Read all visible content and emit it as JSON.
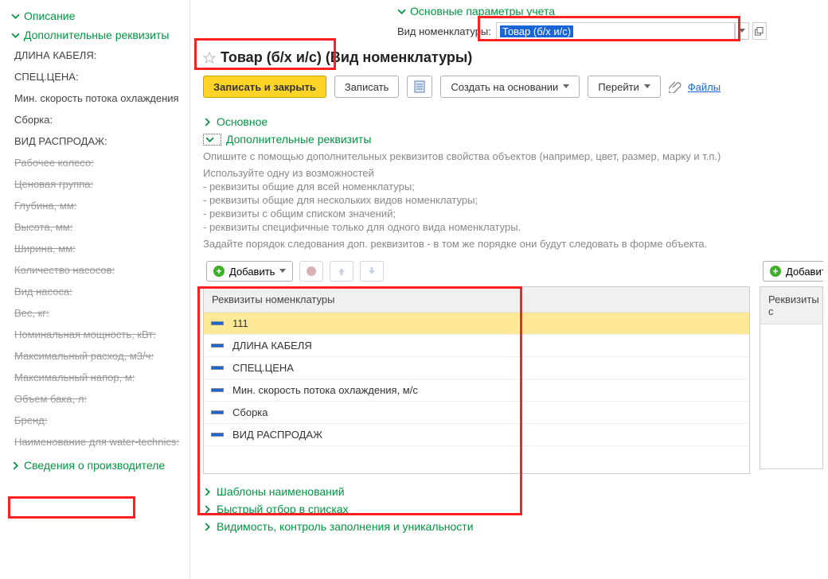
{
  "left": {
    "sec_desc": "Описание",
    "sec_addl": "Дополнительные реквизиты",
    "items_plain": [
      "ДЛИНА КАБЕЛЯ:",
      "СПЕЦ.ЦЕНА:",
      "Мин. скорость потока охлаждения",
      "Сборка:",
      "ВИД РАСПРОДАЖ:"
    ],
    "items_struck": [
      "Рабочее колесо:",
      "Ценовая группа:",
      "Глубина, мм:",
      "Высота, мм:",
      "Ширина, мм:",
      "Количество насосов:",
      "Вид насоса:",
      "Вес, кг:",
      "Номинальная мощность, кВт:",
      "Максимальный расход, м3/ч:",
      "Максимальный напор, м:",
      "Объем бака, л:",
      "Бренд:",
      "Наименование для water-technics:"
    ],
    "sec_manufacturer": "Сведения о производителе"
  },
  "right": {
    "top_sec": "Основные параметры учета",
    "field_label": "Вид номенклатуры:",
    "field_value": "Товар (б/х и/с)",
    "title": "Товар (б/х и/с) (Вид номенклатуры)",
    "btn_save_close": "Записать и закрыть",
    "btn_save": "Записать",
    "btn_create": "Создать на основании",
    "btn_goto": "Перейти",
    "link_files": "Файлы",
    "sec_main": "Основное",
    "sec_addl": "Дополнительные реквизиты",
    "desc1": "Опишите с помощью дополнительных реквизитов свойства объектов (например, цвет, размер, марку и т.п.)",
    "desc2": "Используйте одну из возможностей",
    "desc_list": [
      "- реквизиты общие для всей номенклатуры;",
      "- реквизиты общие для нескольких видов номенклатуры;",
      "- реквизиты с общим списком значений;",
      "- реквизиты специфичные только для одного вида номенклатуры."
    ],
    "desc3": "Задайте порядок следования доп. реквизитов - в том же порядке они будут следовать в форме объекта.",
    "btn_add": "Добавить",
    "grid_header": "Реквизиты номенклатуры",
    "grid_rows": [
      "111",
      "ДЛИНА КАБЕЛЯ",
      "СПЕЦ.ЦЕНА",
      "Мин. скорость потока охлаждения, м/с",
      "Сборка",
      "ВИД РАСПРОДАЖ"
    ],
    "side_btn_add": "Добавит",
    "side_header": "Реквизиты с",
    "sec_templates": "Шаблоны наименований",
    "sec_filter": "Быстрый отбор в списках",
    "sec_visibility": "Видимость, контроль заполнения и уникальности"
  }
}
